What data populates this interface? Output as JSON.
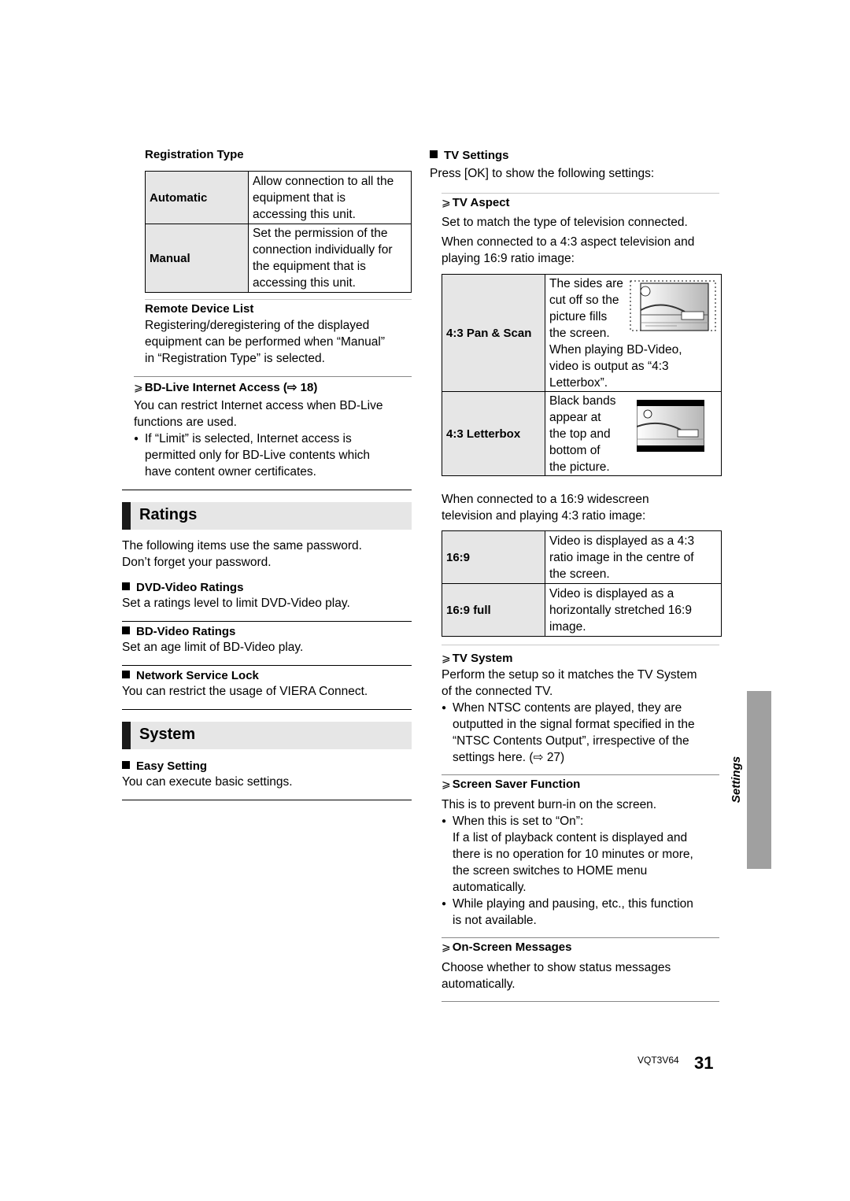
{
  "left": {
    "registration_type": {
      "heading": "Registration Type",
      "rows": [
        {
          "key": "Automatic",
          "lines": [
            "Allow connection to all the",
            "equipment that is",
            "accessing this unit."
          ]
        },
        {
          "key": "Manual",
          "lines": [
            "Set the permission of the",
            "connection individually for",
            "the equipment that is",
            "accessing this unit."
          ]
        }
      ]
    },
    "remote_device_list": {
      "heading": "Remote Device List",
      "lines": [
        "Registering/deregistering of the displayed",
        "equipment can be performed when “Manual”",
        "in “Registration Type” is selected."
      ]
    },
    "bd_live": {
      "arrow": "⩾",
      "heading": "BD-Live Internet Access (⇨ 18)",
      "lines": [
        "You can restrict Internet access when BD-Live",
        "functions are used."
      ],
      "bullet": "●",
      "bullet_lines": [
        "If “Limit” is selected, Internet access is",
        "permitted only for BD-Live contents which",
        "have content owner certificates."
      ]
    },
    "ratings": {
      "title": "Ratings",
      "intro": [
        "The following items use the same password.",
        "Don’t forget your password."
      ],
      "items": [
        {
          "heading": "DVD-Video Ratings",
          "text": "Set a ratings level to limit DVD-Video play."
        },
        {
          "heading": "BD-Video Ratings",
          "text": "Set an age limit of BD-Video play."
        },
        {
          "heading": "Network Service Lock",
          "text": "You can restrict the usage of VIERA Connect."
        }
      ]
    },
    "system": {
      "title": "System",
      "items": [
        {
          "heading": "Easy Setting",
          "text": "You can execute basic settings."
        }
      ]
    }
  },
  "right": {
    "tv_settings": {
      "heading": "TV Settings",
      "text": "Press [OK] to show the following settings:"
    },
    "tv_aspect": {
      "heading": "TV Aspect",
      "lines1": [
        "Set to match the type of television connected."
      ],
      "lines2": [
        "When connected to a 4:3 aspect television and",
        "playing 16:9 ratio image:"
      ],
      "table43": [
        {
          "key": "4:3 Pan & Scan",
          "lines": [
            "The sides are",
            "cut off so the",
            "picture fills",
            "the screen.",
            "When playing BD-Video,",
            "video is output as “4:3",
            "Letterbox”."
          ]
        },
        {
          "key": "4:3 Letterbox",
          "lines": [
            "Black bands",
            "appear at",
            "the top and",
            "bottom of",
            "the picture."
          ]
        }
      ],
      "lines3": [
        "When connected to a 16:9 widescreen",
        "television and playing 4:3 ratio image:"
      ],
      "table169": [
        {
          "key": "16:9",
          "lines": [
            "Video is displayed as a 4:3",
            "ratio image in the centre of",
            "the screen."
          ]
        },
        {
          "key": "16:9 full",
          "lines": [
            "Video is displayed as a",
            "horizontally stretched 16:9",
            "image."
          ]
        }
      ]
    },
    "tv_system": {
      "heading": "TV System",
      "lines": [
        "Perform the setup so it matches the TV System",
        "of the connected TV."
      ],
      "bullet_lines": [
        "When NTSC contents are played, they are",
        "outputted in the signal format specified in the",
        "“NTSC Contents Output”, irrespective of the",
        "settings here. (⇨ 27)"
      ]
    },
    "screen_saver": {
      "heading": "Screen Saver Function",
      "text": "This is to prevent burn-in on the screen.",
      "bullet1": [
        "When this is set to “On”:",
        "If a list of playback content is displayed and",
        "there is no operation for 10 minutes or more,",
        "the screen switches to HOME menu",
        "automatically."
      ],
      "bullet2": [
        "While playing and pausing, etc., this function",
        "is not available."
      ]
    },
    "on_screen": {
      "heading": "On-Screen Messages",
      "lines": [
        "Choose whether to show status messages",
        "automatically."
      ]
    }
  },
  "side_tab": {
    "label": "Settings"
  },
  "footer": {
    "doc_code": "VQT3V64",
    "page_number": "31"
  }
}
